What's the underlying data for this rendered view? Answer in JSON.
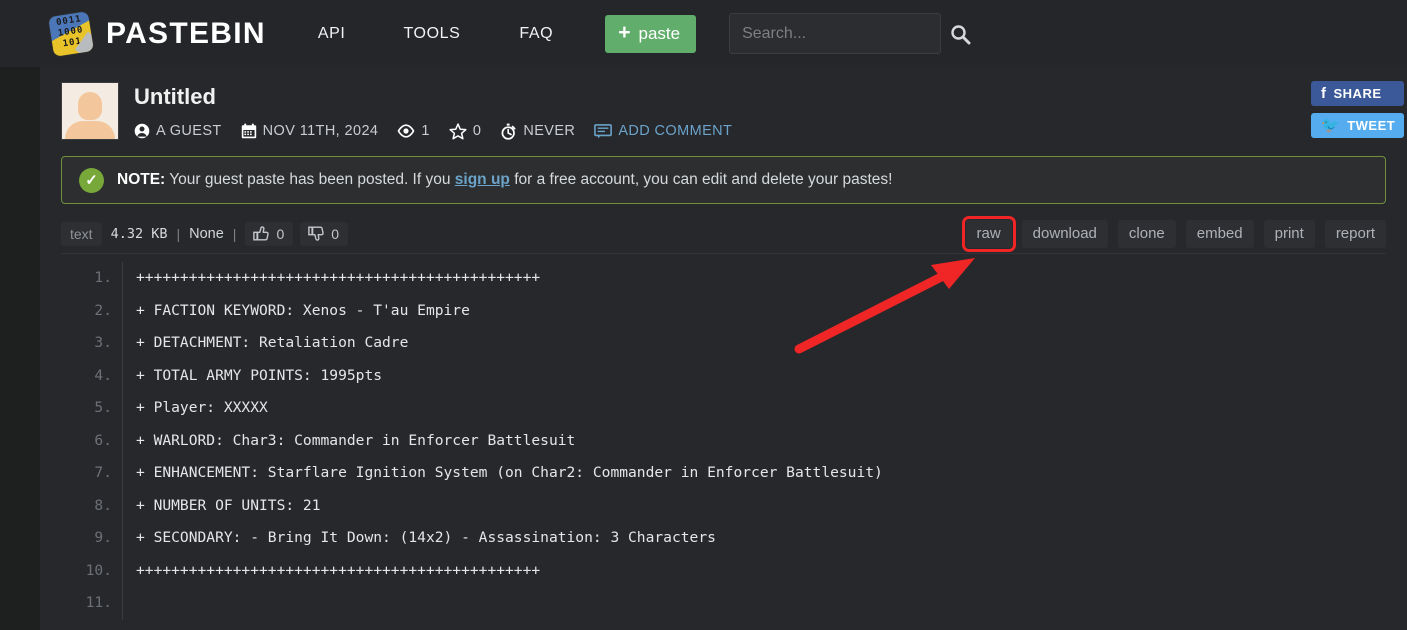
{
  "header": {
    "brand": "PASTEBIN",
    "logo_icon": "pastebin-logo-icon",
    "logo_bits": [
      "0011",
      "1000",
      "101"
    ],
    "nav": [
      {
        "label": "API",
        "name": "nav-api"
      },
      {
        "label": "TOOLS",
        "name": "nav-tools"
      },
      {
        "label": "FAQ",
        "name": "nav-faq"
      }
    ],
    "paste_button": {
      "label": "paste",
      "plus": "+",
      "color": "#61ad6c"
    },
    "search": {
      "value": "",
      "placeholder": "Search...",
      "icon": "search-icon"
    }
  },
  "paste": {
    "title": "Untitled",
    "author": "A GUEST",
    "date": "NOV 11TH, 2024",
    "views": "1",
    "stars": "0",
    "expiry": "NEVER",
    "add_comment": "ADD COMMENT",
    "share": {
      "label": "SHARE",
      "color": "#3b5998"
    },
    "tweet": {
      "label": "TWEET",
      "color": "#55acee"
    }
  },
  "note": {
    "icon": "check-circle-icon",
    "label": "NOTE:",
    "text_before": " Your guest paste has been posted. If you ",
    "link": "sign up",
    "text_after": " for a free account, you can edit and delete your pastes!",
    "border_color": "#6f8f3c",
    "check_color": "#78a73a"
  },
  "toolbar": {
    "format": "text",
    "size": "4.32 KB",
    "separator": "|",
    "language": "None",
    "likes": "0",
    "dislikes": "0",
    "actions": [
      {
        "label": "raw",
        "name": "tool-raw",
        "highlighted": true
      },
      {
        "label": "download",
        "name": "tool-download",
        "highlighted": false
      },
      {
        "label": "clone",
        "name": "tool-clone",
        "highlighted": false
      },
      {
        "label": "embed",
        "name": "tool-embed",
        "highlighted": false
      },
      {
        "label": "print",
        "name": "tool-print",
        "highlighted": false
      },
      {
        "label": "report",
        "name": "tool-report",
        "highlighted": false
      }
    ],
    "highlight_color": "#f02525"
  },
  "code": {
    "line_numbers": [
      "1.",
      "2.",
      "3.",
      "4.",
      "5.",
      "6.",
      "7.",
      "8.",
      "9.",
      "10.",
      "11."
    ],
    "lines": [
      "++++++++++++++++++++++++++++++++++++++++++++++",
      "+ FACTION KEYWORD: Xenos - T'au Empire",
      "+ DETACHMENT: Retaliation Cadre",
      "+ TOTAL ARMY POINTS: 1995pts",
      "+ Player: XXXXX",
      "+ WARLORD: Char3: Commander in Enforcer Battlesuit",
      "+ ENHANCEMENT: Starflare Ignition System (on Char2: Commander in Enforcer Battlesuit)",
      "+ NUMBER OF UNITS: 21",
      "+ SECONDARY: - Bring It Down: (14x2) - Assassination: 3 Characters",
      "++++++++++++++++++++++++++++++++++++++++++++++",
      ""
    ]
  },
  "annotation": {
    "type": "red-arrow",
    "color": "#f02525",
    "points_to": "raw"
  }
}
